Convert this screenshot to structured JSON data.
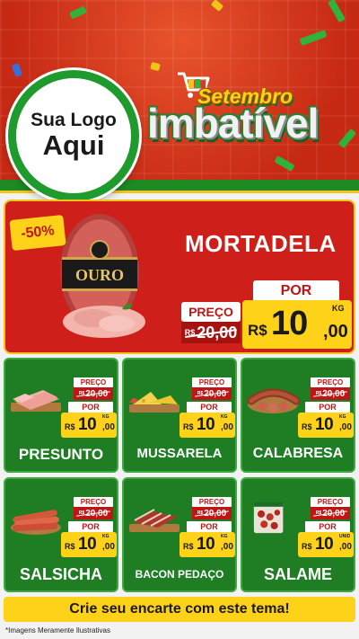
{
  "header": {
    "logo": {
      "line1": "Sua Logo",
      "line2": "Aqui"
    },
    "title": {
      "top": "Setembro",
      "main": "imbatível"
    },
    "colors": {
      "background": "#d8361c",
      "green": "#1d8a24",
      "yellow": "#f6c51a"
    }
  },
  "featured": {
    "discount": "-50%",
    "name": "MORTADELA",
    "price_label": "PREÇO",
    "old_currency": "R$",
    "old_amount": "20,00",
    "por_label": "POR",
    "currency": "R$",
    "price_int": "10",
    "price_dec": ",00",
    "unit": "KG",
    "package_brand": "OURO",
    "package_icon": "sausage-package-icon"
  },
  "products": [
    {
      "name": "PRESUNTO",
      "price_label": "PREÇO",
      "old_currency": "R$",
      "old_amount": "20,00",
      "por_label": "POR",
      "currency": "R$",
      "price_int": "10",
      "price_dec": ",00",
      "unit": "KG",
      "icon": "ham-board-icon"
    },
    {
      "name": "MUSSARELA",
      "price_label": "PREÇO",
      "old_currency": "R$",
      "old_amount": "20,00",
      "por_label": "POR",
      "currency": "R$",
      "price_int": "10",
      "price_dec": ",00",
      "unit": "KG",
      "icon": "cheese-board-icon"
    },
    {
      "name": "CALABRESA",
      "price_label": "PREÇO",
      "old_currency": "R$",
      "old_amount": "20,00",
      "por_label": "POR",
      "currency": "R$",
      "price_int": "10",
      "price_dec": ",00",
      "unit": "KG",
      "icon": "sausage-ring-icon"
    },
    {
      "name": "SALSICHA",
      "price_label": "PREÇO",
      "old_currency": "R$",
      "old_amount": "20,00",
      "por_label": "POR",
      "currency": "R$",
      "price_int": "10",
      "price_dec": ",00",
      "unit": "KG",
      "icon": "hotdog-sausages-icon"
    },
    {
      "name": "BACON PEDAÇO",
      "price_label": "PREÇO",
      "old_currency": "R$",
      "old_amount": "20,00",
      "por_label": "POR",
      "currency": "R$",
      "price_int": "10",
      "price_dec": ",00",
      "unit": "KG",
      "icon": "bacon-board-icon"
    },
    {
      "name": "SALAME",
      "price_label": "PREÇO",
      "old_currency": "R$",
      "old_amount": "20,00",
      "por_label": "POR",
      "currency": "R$",
      "price_int": "10",
      "price_dec": ",00",
      "unit": "UNID",
      "icon": "salami-package-icon"
    }
  ],
  "footer": {
    "cta": "Crie seu encarte com este tema!",
    "disclaimer": "*Imagens Meramente Ilustrativas"
  }
}
